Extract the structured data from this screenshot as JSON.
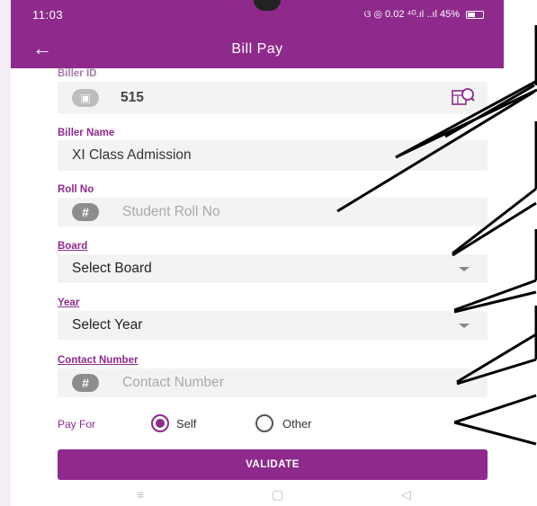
{
  "status_bar": {
    "time": "11:03",
    "icons_text": "ଓ ◎ 0.02 ⁴ᴳ.ıl ..ıl 45%"
  },
  "app_bar": {
    "title": "Bill Pay",
    "back_icon": "arrow-left-icon"
  },
  "form": {
    "biller_id": {
      "label": "Biller ID",
      "value": "515",
      "lookup_icon": "search-list-icon"
    },
    "biller_name": {
      "label": "Biller Name",
      "value": "XI Class Admission"
    },
    "roll_no": {
      "label": "Roll No",
      "placeholder": "Student Roll No",
      "badge": "#"
    },
    "board": {
      "label": "Board",
      "selected": "Select Board"
    },
    "year": {
      "label": "Year",
      "selected": "Select Year"
    },
    "contact_number": {
      "label": "Contact Number",
      "placeholder": "Contact Number",
      "badge": "#"
    },
    "pay_for": {
      "label": "Pay For",
      "options": [
        "Self",
        "Other"
      ],
      "selected": "Self"
    },
    "validate_label": "VALIDATE"
  },
  "nav_bar": {
    "recent": "≡",
    "home": "▢",
    "back": "◁"
  },
  "colors": {
    "primary": "#8e2a8c",
    "field_bg": "#f3f3f3",
    "placeholder": "#a9a9a9"
  }
}
